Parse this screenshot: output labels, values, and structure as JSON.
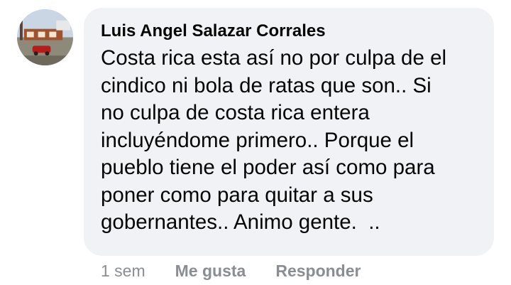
{
  "comment": {
    "avatar_icon": "profile-photo-icon",
    "author": "Luis Angel Salazar Corrales",
    "text": "Costa rica esta así no por culpa de el\ncindico ni bola de ratas que son.. Si\nno culpa de costa rica entera\nincluyéndome primero.. Porque el\npueblo tiene el poder así como para\nponer como para quitar a sus\ngobernantes.. Animo gente.  ..",
    "timestamp": "1 sem",
    "like_label": "Me gusta",
    "reply_label": "Responder"
  },
  "colors": {
    "bubble_background": "#f0f2f5",
    "text": "#050505",
    "secondary_text": "#8a8d91"
  }
}
